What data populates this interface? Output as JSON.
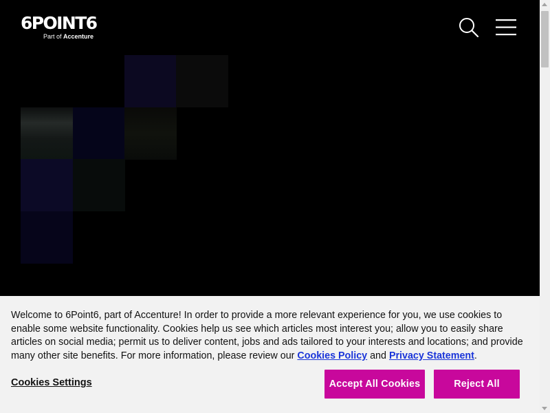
{
  "header": {
    "logo_text": "6POINT6",
    "logo_sub_prefix": "Part of",
    "logo_sub_brand": "Accenture",
    "search_icon": "search-icon",
    "menu_icon": "hamburger-menu-icon"
  },
  "hero": {
    "tile_colors": {
      "r1c3": "#0c0921",
      "r1c4": "#0b0b0b",
      "r2c1": "#1a1e1c",
      "r2c2": "#05051a",
      "r2c3": "#0b0c09",
      "r3c1": "#0c0a26",
      "r3c2": "#080c0b",
      "r4c1": "#06051a"
    }
  },
  "cookie_banner": {
    "message_start": "Welcome to 6Point6, part of Accenture! In order to provide a more relevant experience for you, we use cookies to enable some website functionality. Cookies help us see which articles most interest you; allow you to easily share articles on social media; permit us to deliver content, jobs and ads tailored to your interests and locations; and provide many other site benefits. For more information, please review our",
    "cookies_policy_link": "Cookies Policy",
    "and_text": "and",
    "privacy_statement_link": "Privacy Statement",
    "period": ".",
    "settings_label": "Cookies Settings",
    "accept_label": "Accept All Cookies",
    "reject_label": "Reject All",
    "accent_color": "#c8089c",
    "link_color": "#1a35d9"
  }
}
